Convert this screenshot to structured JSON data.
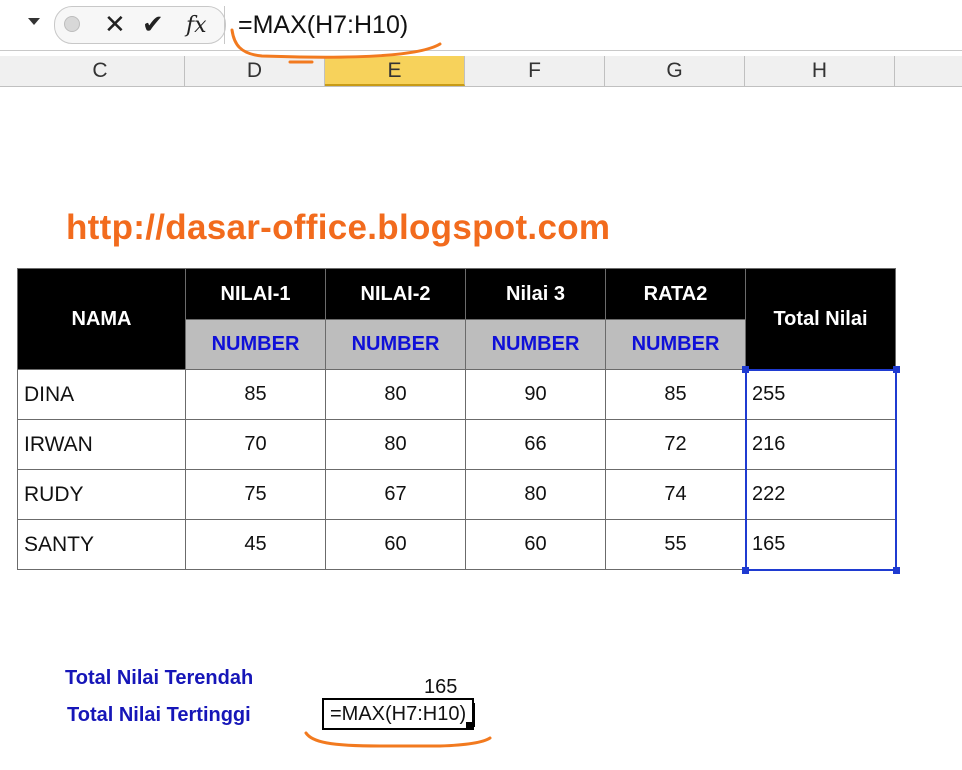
{
  "formula_bar": {
    "cancel_icon": "✕",
    "confirm_icon": "✔",
    "fx_label": "fx",
    "formula": "=MAX(H7:H10)"
  },
  "columns": [
    "C",
    "D",
    "E",
    "F",
    "G",
    "H"
  ],
  "selected_column": "E",
  "watermark": "http://dasar-office.blogspot.com",
  "table": {
    "header_nama": "NAMA",
    "header_total": "Total Nilai",
    "headers": [
      "NILAI-1",
      "NILAI-2",
      "Nilai 3",
      "RATA2"
    ],
    "subheaders": [
      "NUMBER",
      "NUMBER",
      "NUMBER",
      "NUMBER"
    ],
    "rows": [
      {
        "nama": "DINA",
        "values": [
          "85",
          "80",
          "90",
          "85"
        ],
        "total": "255"
      },
      {
        "nama": "IRWAN",
        "values": [
          "70",
          "80",
          "66",
          "72"
        ],
        "total": "216"
      },
      {
        "nama": "RUDY",
        "values": [
          "75",
          "67",
          "80",
          "74"
        ],
        "total": "222"
      },
      {
        "nama": "SANTY",
        "values": [
          "45",
          "60",
          "60",
          "55"
        ],
        "total": "165"
      }
    ]
  },
  "summary": {
    "min_label": "Total Nilai Terendah",
    "max_label": "Total Nilai Tertinggi",
    "min_value": "165",
    "editing_formula": "=MAX(H7:H10)"
  },
  "colors": {
    "watermark": "#f26b1d",
    "selection": "#1f3bd1",
    "label_blue": "#1616b8",
    "annotation": "#f27a1f"
  }
}
